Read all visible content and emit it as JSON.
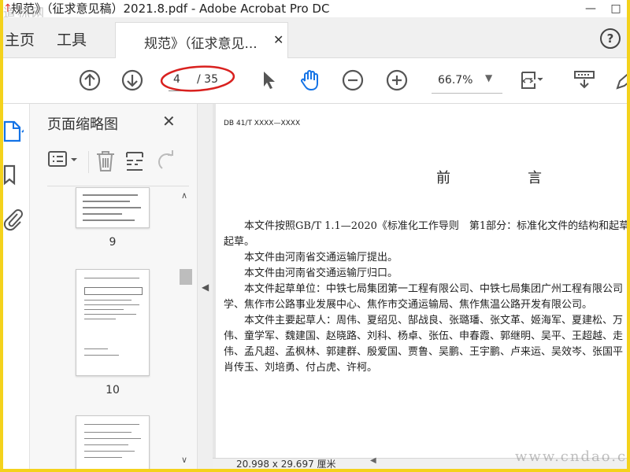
{
  "window": {
    "title": "规范》（征求意见稿）2021.8.pdf - Adobe Acrobat Pro DC",
    "watermark_top": "道标网",
    "watermark_bottom": "www.cndao.com"
  },
  "tabs": {
    "home": "主页",
    "tools": "工具",
    "document": "规范》（征求意见...",
    "help": "?"
  },
  "toolbar": {
    "current_page": "4",
    "total_pages": "/ 35",
    "zoom": "66.7%",
    "accent_color": "#1473e6",
    "annotation_color": "#d9211f"
  },
  "thumbnail_panel": {
    "title": "页面缩略图",
    "pages": [
      "9",
      "10"
    ]
  },
  "document": {
    "code": "DB 41/T XXXX—XXXX",
    "heading": "前　言",
    "lines": [
      "本文件按照GB/T 1.1—2020《标准化工作导则　第1部分：标准化文件的结构和起草",
      "起草。",
      "本文件由河南省交通运输厅提出。",
      "本文件由河南省交通运输厅归口。",
      "本文件起草单位：中铁七局集团第一工程有限公司、中铁七局集团广州工程有限公司",
      "学、焦作市公路事业发展中心、焦作市交通运输局、焦作焦温公路开发有限公司。",
      "本文件主要起草人：周伟、夏绍见、郜战良、张璐璠、张文革、姬海军、夏建松、万",
      "伟、童学军、魏建国、赵晓路、刘科、杨卓、张伍、申春霞、郭继明、吴平、王超越、走",
      "伟、孟凡超、孟枫林、郭建群、殷爱国、贾鲁、吴鹏、王宇鹏、卢来运、吴效岑、张国平",
      "肖传玉、刘培勇、付占虎、许柯。"
    ]
  },
  "status": {
    "page_size": "20.998 x 29.697 厘米"
  }
}
